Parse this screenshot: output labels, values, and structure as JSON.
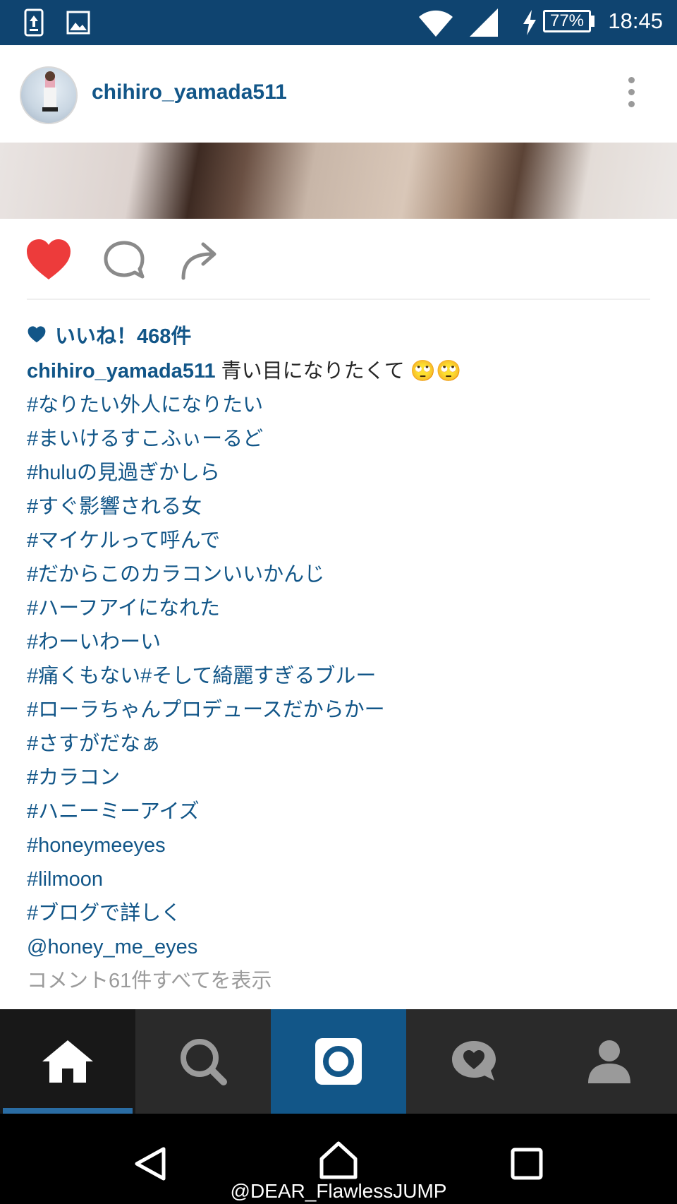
{
  "status_bar": {
    "time": "18:45",
    "battery": "77%",
    "battery_level": 0.77,
    "icons": [
      "upload-notification-icon",
      "image-notification-icon",
      "wifi-icon",
      "cell-signal-icon",
      "charging-icon",
      "battery-icon"
    ]
  },
  "post": {
    "username": "chihiro_yamada511",
    "likes_text": "いいね！468件",
    "caption_text": "青い目になりたくて 🙄🙄",
    "hashtags": [
      "#なりたい外人になりたい",
      "#まいけるすこふぃーるど",
      "#huluの見過ぎかしら",
      "#すぐ影響される女",
      "#マイケルって呼んで",
      "#だからこのカラコンいいかんじ",
      "#ハーフアイになれた",
      "#わーいわーい",
      "#痛くもない#そして綺麗すぎるブルー",
      "#ローラちゃんプロデュースだからかー",
      "#さすがだなぁ",
      "#カラコン",
      "#ハニーミーアイズ",
      "#honeymeeyes",
      "#lilmoon",
      "#ブログで詳しく",
      "@honey_me_eyes"
    ],
    "view_all_comments": "コメント61件すべてを表示",
    "next_comment_partial": "",
    "liked": true,
    "colors": {
      "link": "#125688",
      "like_red": "#ed3b3b",
      "header_bar": "#0f4470"
    }
  },
  "tabbar": {
    "tabs": [
      "home",
      "search",
      "camera",
      "activity",
      "profile"
    ],
    "active": "home"
  },
  "watermark": "@DEAR_FlawlessJUMP"
}
